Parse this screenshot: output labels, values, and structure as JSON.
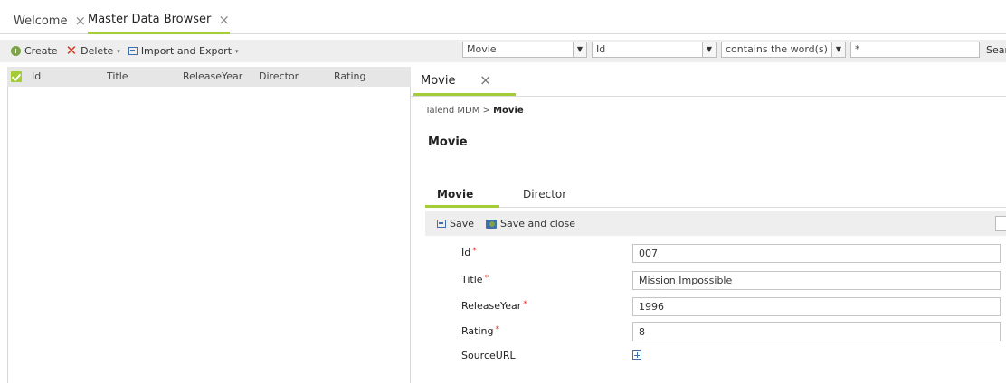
{
  "top_tabs": [
    {
      "label": "Welcome",
      "active": false
    },
    {
      "label": "Master Data Browser",
      "active": true
    }
  ],
  "toolbar": {
    "create_label": "Create",
    "delete_label": "Delete",
    "import_export_label": "Import and Export"
  },
  "search": {
    "entity": "Movie",
    "field": "Id",
    "operator": "contains the word(s)",
    "value": "*",
    "search_label": "Sear"
  },
  "grid": {
    "columns": [
      "Id",
      "Title",
      "ReleaseYear",
      "Director",
      "Rating"
    ],
    "rows": []
  },
  "detail": {
    "tab_label": "Movie",
    "breadcrumb_root": "Talend MDM",
    "breadcrumb_sep": ">",
    "breadcrumb_current": "Movie",
    "title": "Movie",
    "sub_tabs": [
      {
        "label": "Movie",
        "active": true
      },
      {
        "label": "Director",
        "active": false
      }
    ],
    "toolbar": {
      "save_label": "Save",
      "save_close_label": "Save and close"
    },
    "fields": [
      {
        "label": "Id",
        "required": true,
        "value": "007"
      },
      {
        "label": "Title",
        "required": true,
        "value": "Mission Impossible"
      },
      {
        "label": "ReleaseYear",
        "required": true,
        "value": "1996"
      },
      {
        "label": "Rating",
        "required": true,
        "value": "8"
      },
      {
        "label": "SourceURL",
        "required": false,
        "value": ""
      }
    ],
    "required_marker": "*"
  },
  "icons": {
    "close": "×",
    "dropdown": "▾",
    "select_arrow": "▼"
  },
  "colors": {
    "accent": "#a4cc36",
    "required": "#e0332a",
    "toolbar_bg": "#eeeeee"
  }
}
